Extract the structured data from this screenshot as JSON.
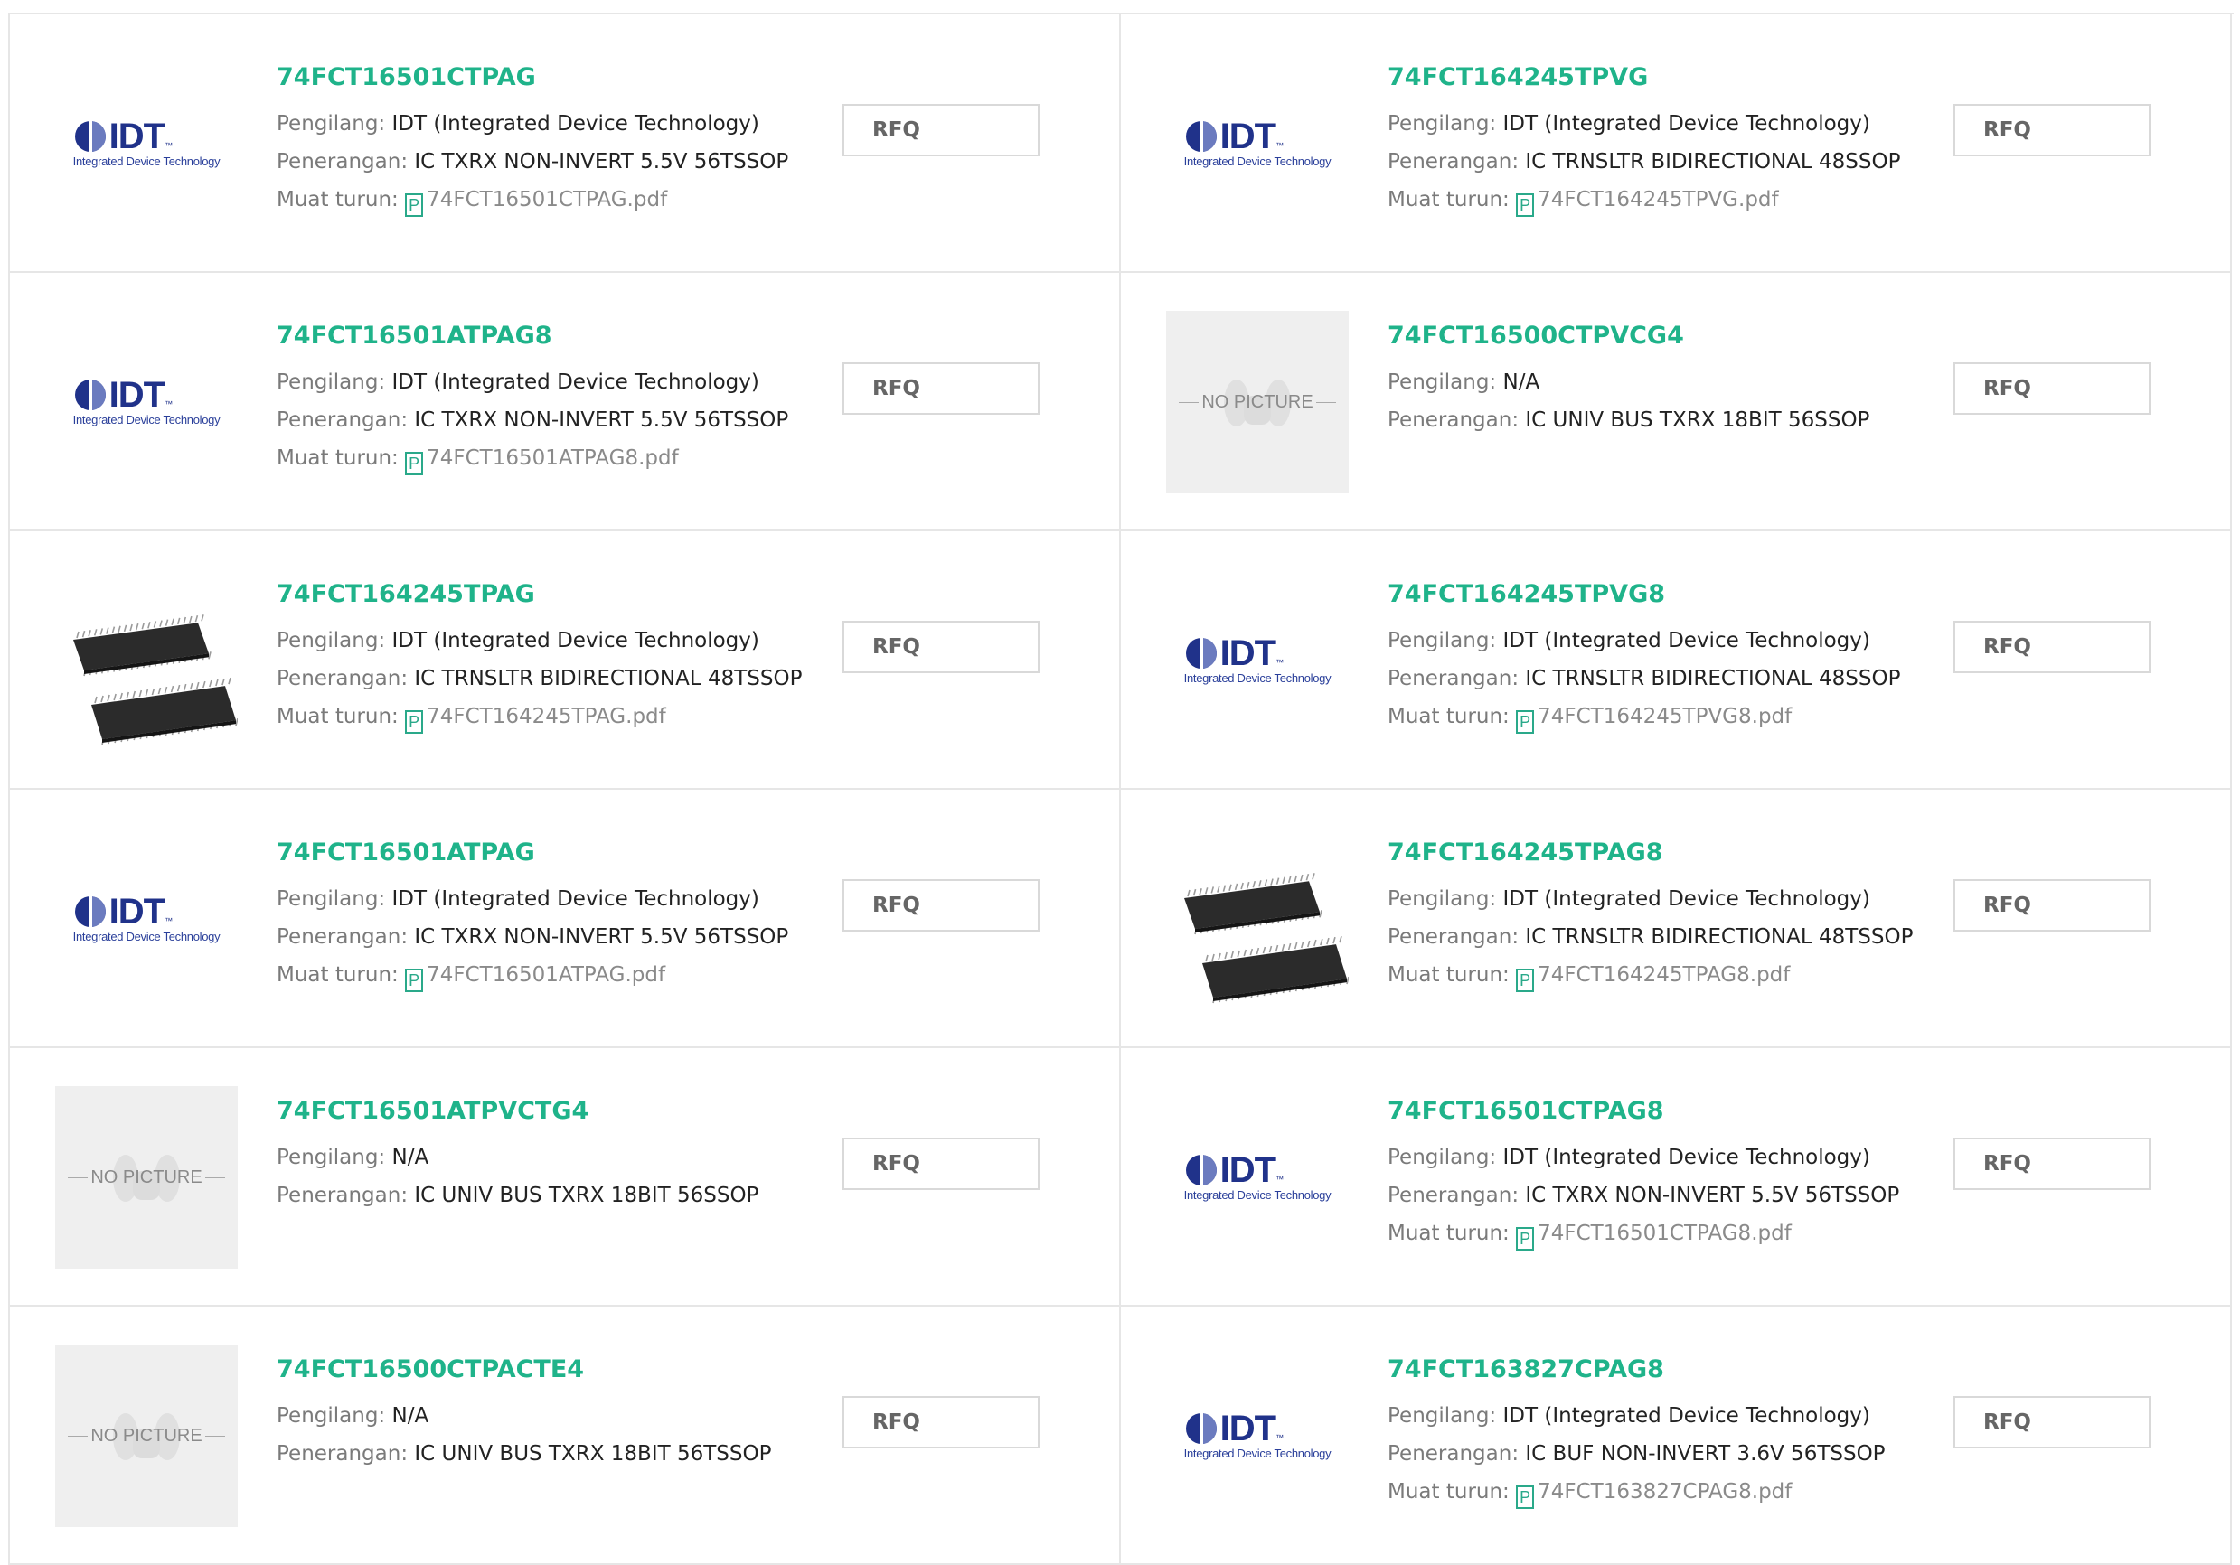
{
  "labels": {
    "manufacturer": "Pengilang:",
    "description": "Penerangan:",
    "download": "Muat turun:",
    "rfq": "RFQ",
    "no_picture": "NO PICTURE",
    "idt_logo_text": "IDT",
    "idt_logo_sub": "Integrated Device Technology",
    "idt_logo_tm": "™"
  },
  "colors": {
    "part_name": "#1fb38a",
    "idt_blue": "#20328a"
  },
  "products": [
    {
      "name": "74FCT16501CTPAG",
      "image": "idt-logo",
      "manufacturer": "IDT (Integrated Device Technology)",
      "description": "IC TXRX NON-INVERT 5.5V 56TSSOP",
      "pdf": "74FCT16501CTPAG.pdf"
    },
    {
      "name": "74FCT164245TPVG",
      "image": "idt-logo",
      "manufacturer": "IDT (Integrated Device Technology)",
      "description": "IC TRNSLTR BIDIRECTIONAL 48SSOP",
      "pdf": "74FCT164245TPVG.pdf"
    },
    {
      "name": "74FCT16501ATPAG8",
      "image": "idt-logo",
      "manufacturer": "IDT (Integrated Device Technology)",
      "description": "IC TXRX NON-INVERT 5.5V 56TSSOP",
      "pdf": "74FCT16501ATPAG8.pdf"
    },
    {
      "name": "74FCT16500CTPVCG4",
      "image": "no-picture",
      "manufacturer": "N/A",
      "description": "IC UNIV BUS TXRX 18BIT 56SSOP",
      "pdf": null
    },
    {
      "name": "74FCT164245TPAG",
      "image": "chip-photo",
      "manufacturer": "IDT (Integrated Device Technology)",
      "description": "IC TRNSLTR BIDIRECTIONAL 48TSSOP",
      "pdf": "74FCT164245TPAG.pdf"
    },
    {
      "name": "74FCT164245TPVG8",
      "image": "idt-logo",
      "manufacturer": "IDT (Integrated Device Technology)",
      "description": "IC TRNSLTR BIDIRECTIONAL 48SSOP",
      "pdf": "74FCT164245TPVG8.pdf"
    },
    {
      "name": "74FCT16501ATPAG",
      "image": "idt-logo",
      "manufacturer": "IDT (Integrated Device Technology)",
      "description": "IC TXRX NON-INVERT 5.5V 56TSSOP",
      "pdf": "74FCT16501ATPAG.pdf"
    },
    {
      "name": "74FCT164245TPAG8",
      "image": "chip-photo",
      "manufacturer": "IDT (Integrated Device Technology)",
      "description": "IC TRNSLTR BIDIRECTIONAL 48TSSOP",
      "pdf": "74FCT164245TPAG8.pdf"
    },
    {
      "name": "74FCT16501ATPVCTG4",
      "image": "no-picture",
      "manufacturer": "N/A",
      "description": "IC UNIV BUS TXRX 18BIT 56SSOP",
      "pdf": null
    },
    {
      "name": "74FCT16501CTPAG8",
      "image": "idt-logo",
      "manufacturer": "IDT (Integrated Device Technology)",
      "description": "IC TXRX NON-INVERT 5.5V 56TSSOP",
      "pdf": "74FCT16501CTPAG8.pdf"
    },
    {
      "name": "74FCT16500CTPACTE4",
      "image": "no-picture",
      "manufacturer": "N/A",
      "description": "IC UNIV BUS TXRX 18BIT 56TSSOP",
      "pdf": null
    },
    {
      "name": "74FCT163827CPAG8",
      "image": "idt-logo",
      "manufacturer": "IDT (Integrated Device Technology)",
      "description": "IC BUF NON-INVERT 3.6V 56TSSOP",
      "pdf": "74FCT163827CPAG8.pdf"
    }
  ]
}
